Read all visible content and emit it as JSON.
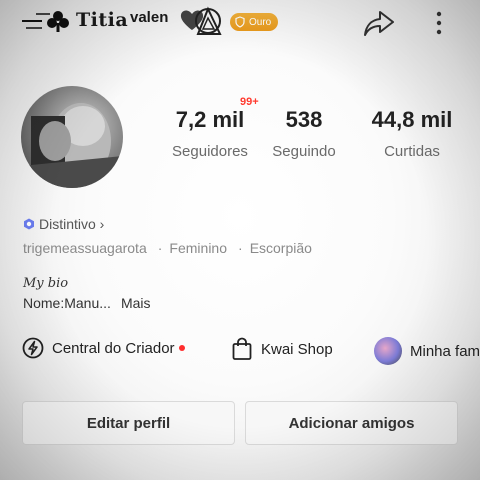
{
  "header": {
    "name_display": "Titia",
    "name_suffix": "valen",
    "badge_label": "Ouro",
    "badge_color": "#eea52a"
  },
  "icons": {
    "share": "share-arrow-icon",
    "more": "more-vertical-icon"
  },
  "profile": {
    "notification_badge": "99+",
    "stats": [
      {
        "value": "7,2 mil",
        "label": "Seguidores"
      },
      {
        "value": "538",
        "label": "Seguindo"
      },
      {
        "value": "44,8 mil",
        "label": "Curtidas"
      }
    ],
    "distintivo": "Distintivo ›",
    "username": "trigemeassuagarota",
    "gender": "Feminino",
    "sign": "Escorpião",
    "bio_title": "My bio",
    "bio_text": "Nome:Manu...",
    "bio_more": "Mais"
  },
  "shortcuts": [
    {
      "label": "Central do Criador",
      "icon": "creator-bolt-icon"
    },
    {
      "label": "Kwai Shop",
      "icon": "shopping-bag-icon"
    },
    {
      "label": "Minha fam",
      "icon": "family-avatar-icon"
    }
  ],
  "buttons": {
    "edit": "Editar perfil",
    "add": "Adicionar amigos"
  },
  "colors": {
    "notification": "#ff3b30",
    "badge_ouro": "#eea52a",
    "distintivo_icon": "#6b7df0"
  }
}
